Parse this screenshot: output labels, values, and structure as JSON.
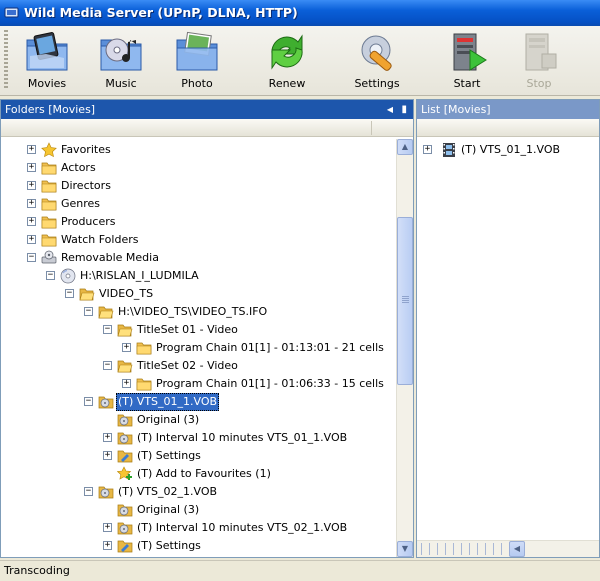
{
  "window": {
    "title": "Wild Media Server (UPnP, DLNA, HTTP)",
    "icon": "app-icon"
  },
  "toolbar": {
    "buttons": [
      {
        "label": "Movies",
        "icon": "movies-folder-icon"
      },
      {
        "label": "Music",
        "icon": "music-folder-icon"
      },
      {
        "label": "Photo",
        "icon": "photo-folder-icon"
      },
      {
        "label": "Renew",
        "icon": "renew-arrows-icon"
      },
      {
        "label": "Settings",
        "icon": "settings-wrench-icon"
      },
      {
        "label": "Start",
        "icon": "start-server-icon"
      },
      {
        "label": "Stop",
        "icon": "stop-server-icon",
        "disabled": true
      }
    ]
  },
  "left_panel": {
    "title": "Folders [Movies]",
    "tree": [
      {
        "label": "Favorites",
        "icon": "star-icon",
        "level": 0,
        "expander": "+"
      },
      {
        "label": "Actors",
        "icon": "folder-icon",
        "level": 0,
        "expander": "+"
      },
      {
        "label": "Directors",
        "icon": "folder-icon",
        "level": 0,
        "expander": "+"
      },
      {
        "label": "Genres",
        "icon": "folder-icon",
        "level": 0,
        "expander": "+"
      },
      {
        "label": "Producers",
        "icon": "folder-icon",
        "level": 0,
        "expander": "+"
      },
      {
        "label": "Watch Folders",
        "icon": "folder-icon",
        "level": 0,
        "expander": "+"
      },
      {
        "label": "Removable Media",
        "icon": "removable-drive-icon",
        "level": 0,
        "expander": "−"
      },
      {
        "label": "H:\\RISLAN_I_LUDMILA",
        "icon": "disc-icon",
        "level": 1,
        "expander": "−"
      },
      {
        "label": "VIDEO_TS",
        "icon": "folder-open-icon",
        "level": 2,
        "expander": "−"
      },
      {
        "label": "H:\\VIDEO_TS\\VIDEO_TS.IFO",
        "icon": "folder-open-icon",
        "level": 3,
        "expander": "−"
      },
      {
        "label": "TitleSet 01 - Video",
        "icon": "folder-open-icon",
        "level": 4,
        "expander": "−"
      },
      {
        "label": "Program Chain 01[1] - 01:13:01 - 21 cells",
        "icon": "folder-icon",
        "level": 5,
        "expander": "+"
      },
      {
        "label": "TitleSet 02 - Video",
        "icon": "folder-open-icon",
        "level": 4,
        "expander": "−"
      },
      {
        "label": "Program Chain 01[1] - 01:06:33 - 15 cells",
        "icon": "folder-icon",
        "level": 5,
        "expander": "+"
      },
      {
        "label": "(T) VTS_01_1.VOB",
        "icon": "transcode-folder-icon",
        "level": 3,
        "expander": "−",
        "selected": true
      },
      {
        "label": "Original (3)",
        "icon": "transcode-folder-icon",
        "level": 4,
        "expander": ""
      },
      {
        "label": "(T) Interval 10 minutes VTS_01_1.VOB",
        "icon": "transcode-folder-icon",
        "level": 4,
        "expander": "+"
      },
      {
        "label": "(T) Settings",
        "icon": "settings-folder-icon",
        "level": 4,
        "expander": "+"
      },
      {
        "label": "(T) Add to Favourites (1)",
        "icon": "add-favourite-icon",
        "level": 4,
        "expander": ""
      },
      {
        "label": "(T) VTS_02_1.VOB",
        "icon": "transcode-folder-icon",
        "level": 3,
        "expander": "−"
      },
      {
        "label": "Original (3)",
        "icon": "transcode-folder-icon",
        "level": 4,
        "expander": ""
      },
      {
        "label": "(T) Interval 10 minutes VTS_02_1.VOB",
        "icon": "transcode-folder-icon",
        "level": 4,
        "expander": "+"
      },
      {
        "label": "(T) Settings",
        "icon": "settings-folder-icon",
        "level": 4,
        "expander": "+"
      }
    ]
  },
  "right_panel": {
    "title": "List [Movies]",
    "items": [
      {
        "label": "(T) VTS_01_1.VOB",
        "icon": "film-icon"
      }
    ]
  },
  "status": {
    "text": "Transcoding"
  },
  "colors": {
    "selection": "#316ac5",
    "panel_header": "#1d56ac",
    "titlebar": "#0a5fd8"
  }
}
